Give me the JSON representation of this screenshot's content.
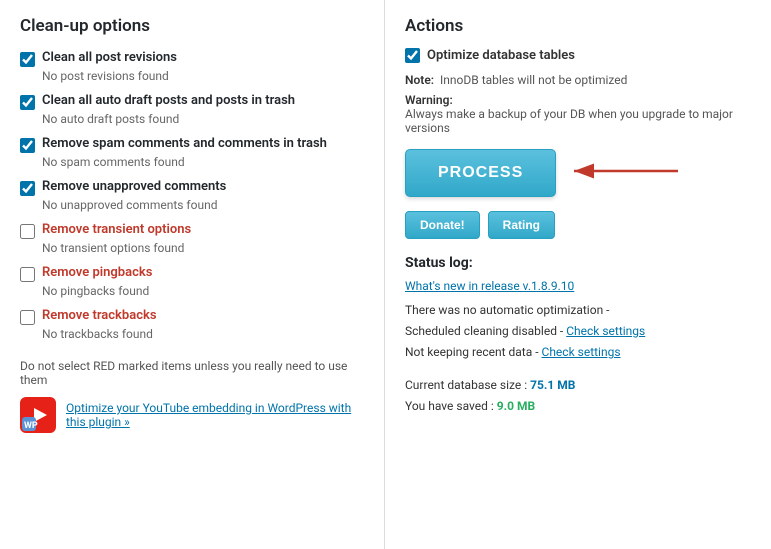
{
  "left": {
    "title": "Clean-up options",
    "options": [
      {
        "id": "opt1",
        "label": "Clean all post revisions",
        "checked": true,
        "red": false,
        "subtext": "No post revisions found"
      },
      {
        "id": "opt2",
        "label": "Clean all auto draft posts and posts in trash",
        "checked": true,
        "red": false,
        "subtext": "No auto draft posts found"
      },
      {
        "id": "opt3",
        "label": "Remove spam comments and comments in trash",
        "checked": true,
        "red": false,
        "subtext": "No spam comments found"
      },
      {
        "id": "opt4",
        "label": "Remove unapproved comments",
        "checked": true,
        "red": false,
        "subtext": "No unapproved comments found"
      },
      {
        "id": "opt5",
        "label": "Remove transient options",
        "checked": false,
        "red": true,
        "subtext": "No transient options found"
      },
      {
        "id": "opt6",
        "label": "Remove pingbacks",
        "checked": false,
        "red": true,
        "subtext": "No pingbacks found"
      },
      {
        "id": "opt7",
        "label": "Remove trackbacks",
        "checked": false,
        "red": true,
        "subtext": "No trackbacks found"
      }
    ],
    "note": "Do not select RED marked items unless you really need to use them",
    "plugin_ad_link": "Optimize your YouTube embedding in WordPress with this plugin »"
  },
  "right": {
    "title": "Actions",
    "checkbox_label": "Optimize database tables",
    "checkbox_checked": true,
    "note_label": "Note:",
    "note_text": "InnoDB tables will not be optimized",
    "warning_label": "Warning:",
    "warning_text": "Always make a backup of your DB when you upgrade to major versions",
    "process_btn": "PROCESS",
    "donate_btn": "Donate!",
    "rating_btn": "Rating",
    "status_log_title": "Status log:",
    "status_link": "What's new in release v.1.8.9.10",
    "status_line1": "There was no automatic optimization -",
    "status_line2": "Scheduled cleaning disabled -",
    "status_link2": "Check settings",
    "status_line3": "Not keeping recent data -",
    "status_link3": "Check settings",
    "db_size_label": "Current database size :",
    "db_size_value": "75.1 MB",
    "db_saved_label": "You have saved :",
    "db_saved_value": "9.0 MB"
  }
}
